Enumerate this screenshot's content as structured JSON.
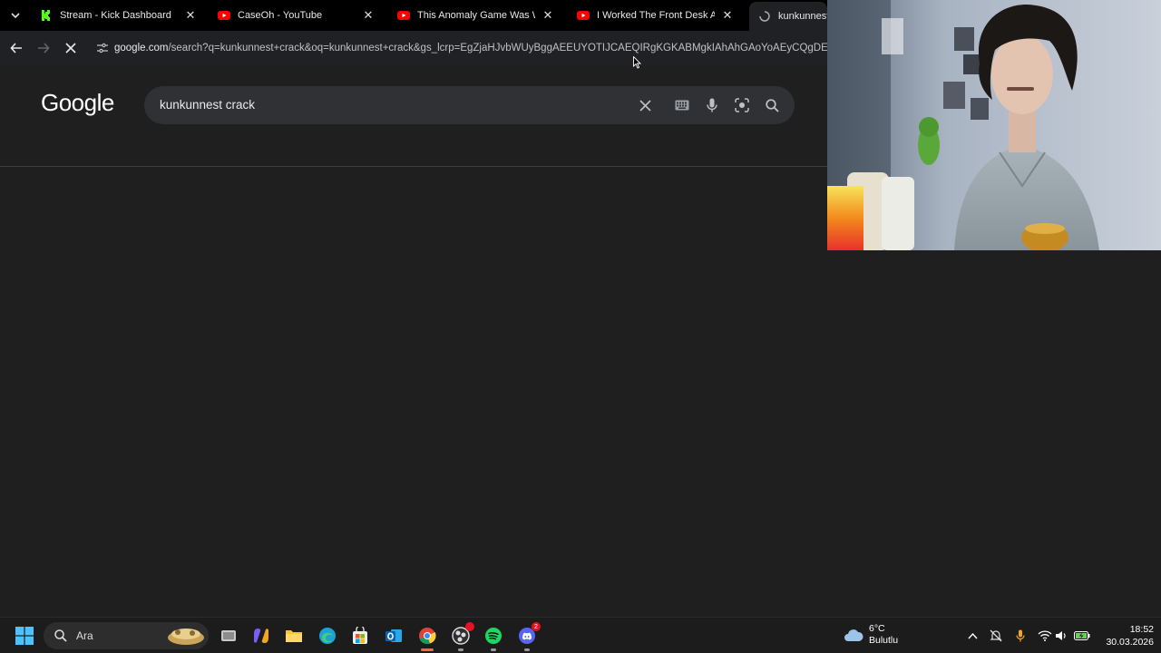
{
  "browser": {
    "tabs": [
      {
        "title": "Stream - Kick Dashboard",
        "icon": "kick-icon"
      },
      {
        "title": "CaseOh - YouTube",
        "icon": "youtube-icon"
      },
      {
        "title": "This Anomaly Game Was Wild...",
        "icon": "youtube-icon"
      },
      {
        "title": "I Worked The Front Desk At A M",
        "icon": "youtube-icon"
      },
      {
        "title": "kunkunnest c",
        "icon": "loading-icon",
        "active": true
      }
    ],
    "address": {
      "host": "google.com",
      "path": "/search?q=kunkunnest+crack&oq=kunkunnest+crack&gs_lcrp=EgZjaHJvbWUyBggAEEUYOTIJCAEQIRgKGKABMgkIAhAhGAoYoAEyCQgDECE"
    }
  },
  "google": {
    "logo": "Google",
    "query": "kunkunnest crack"
  },
  "taskbar": {
    "search_label": "Ara",
    "weather_temp": "6°C",
    "weather_desc": "Bulutlu",
    "time": "18:52",
    "date": "30.03.2026",
    "discord_badge": "2"
  },
  "colors": {
    "page_bg": "#1f1f1f",
    "searchbox_bg": "#303134",
    "kick_green": "#53fc18",
    "youtube_red": "#ff0000",
    "windows_blue": "#0078d4"
  }
}
